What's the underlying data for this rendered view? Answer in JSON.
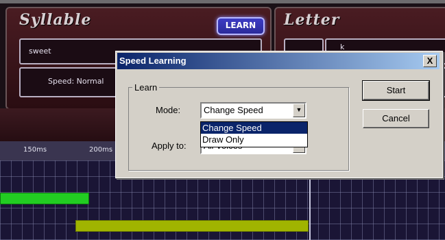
{
  "app": {
    "syllable_title": "Syllable",
    "learn_button": "LEARN",
    "syllable_field": "sweet",
    "speed_field": "Speed: Normal",
    "letter_title": "Letter",
    "letter_field_partial": "k",
    "ruler_ticks": [
      "150ms",
      "200ms"
    ],
    "colors": {
      "green_bar": "#22cc22",
      "olive_bar": "#a0b400",
      "panel": "#3a141a",
      "accent_button": "#3434b8"
    }
  },
  "dialog": {
    "title": "Speed Learning",
    "close_label": "X",
    "group_label": "Learn",
    "mode_label": "Mode:",
    "mode_value": "Change Speed",
    "apply_label": "Apply to:",
    "apply_value": "All Voices",
    "options": [
      "Change Speed",
      "Draw Only"
    ],
    "start_label": "Start",
    "cancel_label": "Cancel"
  }
}
